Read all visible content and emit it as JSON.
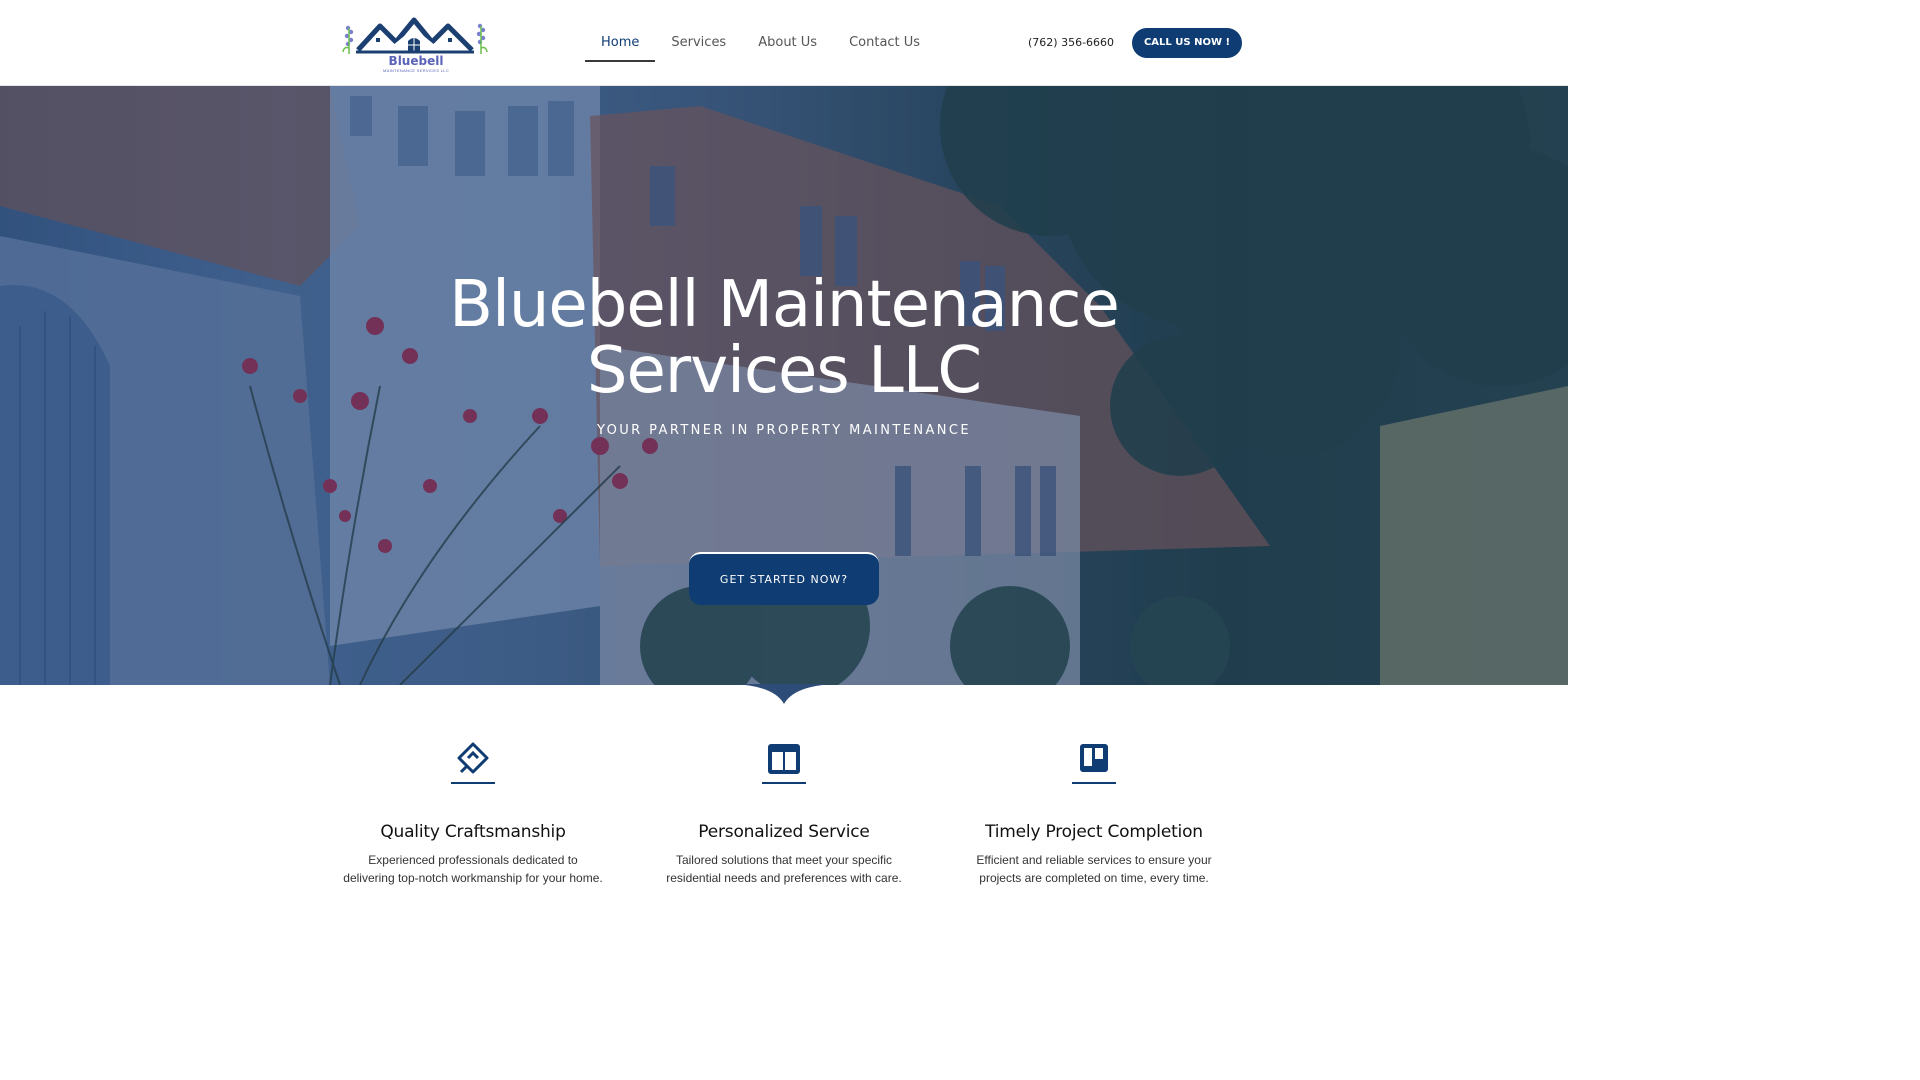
{
  "header": {
    "logo": {
      "name": "Bluebell",
      "subtitle": "MAINTENANCE SERVICES LLC"
    },
    "nav": [
      {
        "label": "Home",
        "active": true
      },
      {
        "label": "Services",
        "active": false
      },
      {
        "label": "About Us",
        "active": false
      },
      {
        "label": "Contact Us",
        "active": false
      }
    ],
    "phone": "(762) 356-6660",
    "call_button": "CALL US NOW !"
  },
  "hero": {
    "title_line1": "Bluebell Maintenance",
    "title_line2": "Services LLC",
    "subtitle": "YOUR PARTNER IN PROPERTY MAINTENANCE",
    "cta": "GET STARTED NOW?",
    "background": "photo-of-row-houses-with-roses-and-trees"
  },
  "features": [
    {
      "icon": "diamond-link-icon",
      "title": "Quality Craftsmanship",
      "line1": "Experienced professionals dedicated to",
      "line2": "delivering top-notch workmanship for your home."
    },
    {
      "icon": "columns-icon",
      "title": "Personalized Service",
      "line1": "Tailored solutions that meet your specific",
      "line2": "residential needs and preferences with care."
    },
    {
      "icon": "board-icon",
      "title": "Timely Project Completion",
      "line1": "Efficient and reliable services to ensure your",
      "line2": "projects are completed on time, every time."
    }
  ],
  "colors": {
    "brand_navy": "#0f3c72",
    "logo_purple": "#5a63b8",
    "hero_overlay": "#163870"
  }
}
